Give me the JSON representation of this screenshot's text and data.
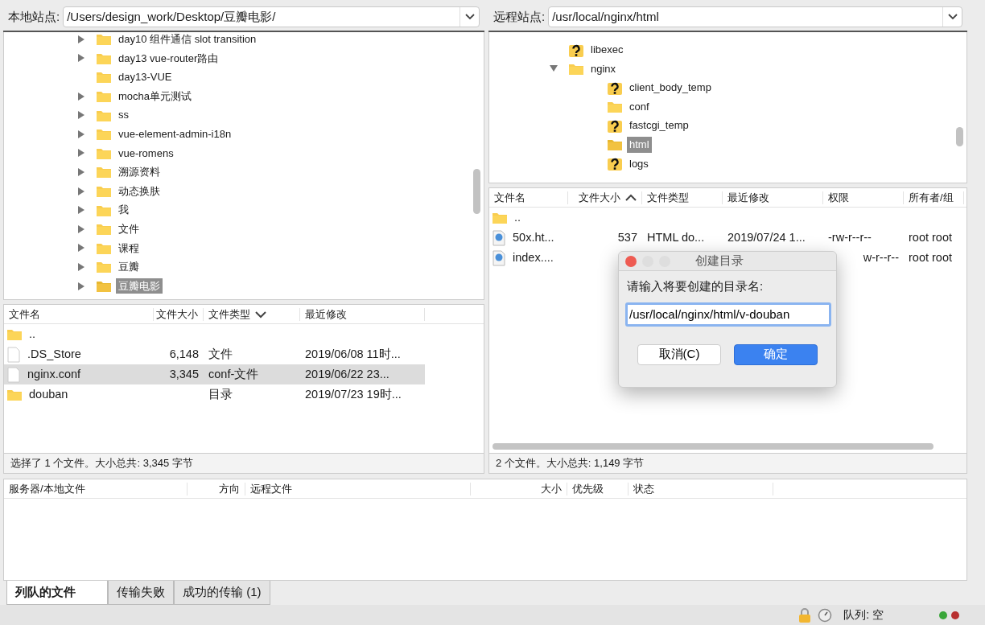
{
  "local": {
    "site_label": "本地站点:",
    "path": "/Users/design_work/Desktop/豆瓣电影/",
    "tree": [
      {
        "name": "day10 组件通信 slot transition",
        "kind": "folder",
        "has_children": true,
        "expanded": false,
        "selected": false
      },
      {
        "name": "day13 vue-router路由",
        "kind": "folder",
        "has_children": true,
        "expanded": false,
        "selected": false
      },
      {
        "name": "day13-VUE",
        "kind": "folder",
        "has_children": false,
        "selected": false
      },
      {
        "name": "mocha单元测试",
        "kind": "folder",
        "has_children": true,
        "expanded": false,
        "selected": false
      },
      {
        "name": "ss",
        "kind": "folder",
        "has_children": true,
        "expanded": false,
        "selected": false
      },
      {
        "name": "vue-element-admin-i18n",
        "kind": "folder",
        "has_children": true,
        "expanded": false,
        "selected": false
      },
      {
        "name": "vue-romens",
        "kind": "folder",
        "has_children": true,
        "expanded": false,
        "selected": false
      },
      {
        "name": "溯源资料",
        "kind": "folder",
        "has_children": true,
        "expanded": false,
        "selected": false
      },
      {
        "name": "动态换肤",
        "kind": "folder",
        "has_children": true,
        "expanded": false,
        "selected": false
      },
      {
        "name": "我",
        "kind": "folder",
        "has_children": true,
        "expanded": false,
        "selected": false
      },
      {
        "name": "文件",
        "kind": "folder",
        "has_children": true,
        "expanded": false,
        "selected": false
      },
      {
        "name": "课程",
        "kind": "folder",
        "has_children": true,
        "expanded": false,
        "selected": false
      },
      {
        "name": "豆瓣",
        "kind": "folder",
        "has_children": true,
        "expanded": false,
        "selected": false
      },
      {
        "name": "豆瓣电影",
        "kind": "folder",
        "has_children": true,
        "expanded": false,
        "selected": true
      }
    ],
    "columns": [
      {
        "label": "文件名",
        "sorted": false
      },
      {
        "label": "文件大小",
        "sorted": false
      },
      {
        "label": "文件类型",
        "sorted": true,
        "ascending": false
      },
      {
        "label": "最近修改",
        "sorted": false
      }
    ],
    "rows": [
      {
        "name": "..",
        "kind": "folder",
        "selected": false
      },
      {
        "name": ".DS_Store",
        "kind": "file",
        "size": "6,148",
        "type": "文件",
        "modified": "2019/06/08 11时...",
        "selected": false
      },
      {
        "name": "nginx.conf",
        "kind": "file",
        "size": "3,345",
        "type": "conf-文件",
        "modified": "2019/06/22 23...",
        "selected": true
      },
      {
        "name": "douban",
        "kind": "folder",
        "type": "目录",
        "modified": "2019/07/23 19时...",
        "selected": false
      }
    ],
    "status": "选择了 1 个文件。大小总共: 3,345 字节"
  },
  "remote": {
    "site_label": "远程站点:",
    "path": "/usr/local/nginx/html",
    "tree": [
      {
        "name": "libexec",
        "kind": "unknown",
        "has_children": false,
        "selected": false
      },
      {
        "name": "nginx",
        "kind": "folder",
        "has_children": true,
        "expanded": true,
        "selected": false,
        "children": [
          {
            "name": "client_body_temp",
            "kind": "unknown",
            "has_children": false,
            "selected": false
          },
          {
            "name": "conf",
            "kind": "folder",
            "has_children": false,
            "selected": false
          },
          {
            "name": "fastcgi_temp",
            "kind": "unknown",
            "has_children": false,
            "selected": false
          },
          {
            "name": "html",
            "kind": "folder",
            "has_children": false,
            "selected": true
          },
          {
            "name": "logs",
            "kind": "unknown",
            "has_children": false,
            "selected": false
          }
        ]
      }
    ],
    "columns": [
      {
        "label": "文件名",
        "sorted": false
      },
      {
        "label": "文件大小",
        "sorted": true,
        "ascending": true
      },
      {
        "label": "文件类型",
        "sorted": false
      },
      {
        "label": "最近修改",
        "sorted": false
      },
      {
        "label": "权限",
        "sorted": false
      },
      {
        "label": "所有者/组",
        "sorted": false
      }
    ],
    "rows": [
      {
        "name": "..",
        "kind": "folder",
        "selected": false
      },
      {
        "name": "50x.ht...",
        "kind": "html",
        "size": "537",
        "type": "HTML do...",
        "modified": "2019/07/24 1...",
        "permissions": "-rw-r--r--",
        "owner": "root root",
        "selected": false
      },
      {
        "name": "index....",
        "kind": "html",
        "permissions": "w-r--r--",
        "owner": "root root",
        "selected": false
      }
    ],
    "status": "2 个文件。大小总共: 1,149 字节"
  },
  "dialog": {
    "title": "创建目录",
    "prompt": "请输入将要创建的目录名:",
    "value": "/usr/local/nginx/html/v-douban",
    "buttons": [
      {
        "label": "取消(C)",
        "kind": "default"
      },
      {
        "label": "确定",
        "kind": "primary"
      }
    ]
  },
  "queue": {
    "columns": [
      "服务器/本地文件",
      "方向",
      "远程文件",
      "大小",
      "优先级",
      "状态"
    ]
  },
  "tabs": [
    {
      "label": "列队的文件",
      "selected": true
    },
    {
      "label": "传输失败",
      "selected": false
    },
    {
      "label": "成功的传输 (1)",
      "selected": false
    }
  ],
  "status_bar": {
    "queue": "队列: 空"
  }
}
